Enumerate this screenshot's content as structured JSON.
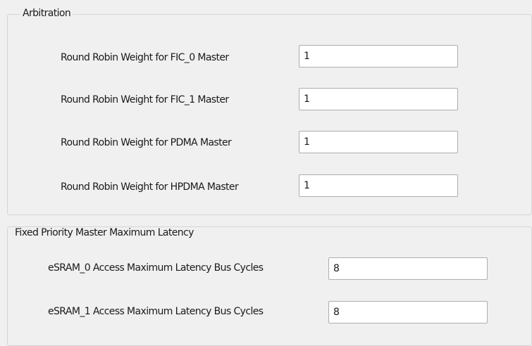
{
  "arbitration": {
    "title": "Arbitration",
    "rows": [
      {
        "label": "Round Robin Weight for FIC_0 Master",
        "value": "1"
      },
      {
        "label": "Round Robin Weight for FIC_1 Master",
        "value": "1"
      },
      {
        "label": "Round Robin Weight for PDMA Master",
        "value": "1"
      },
      {
        "label": "Round Robin Weight for HPDMA Master",
        "value": "1"
      }
    ]
  },
  "fixed_priority": {
    "title": "Fixed Priority Master Maximum Latency",
    "rows": [
      {
        "label": "eSRAM_0 Access Maximum Latency Bus Cycles",
        "value": "8"
      },
      {
        "label": "eSRAM_1 Access Maximum Latency Bus Cycles",
        "value": "8"
      }
    ]
  }
}
